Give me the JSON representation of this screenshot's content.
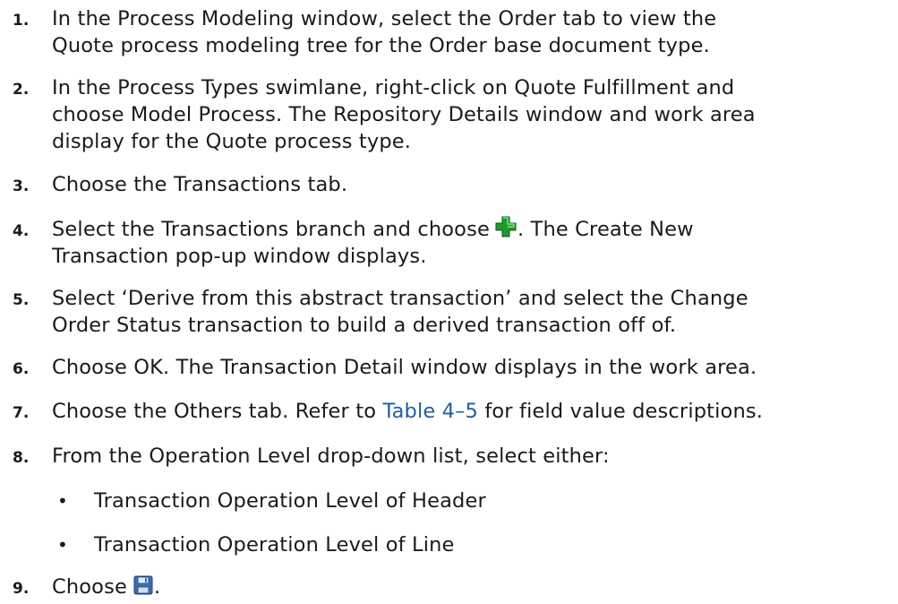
{
  "steps": [
    {
      "number": "1.",
      "lines": [
        "In the Process Modeling window, select the Order tab to view the",
        "Quote process modeling tree for the Order base document type."
      ]
    },
    {
      "number": "2.",
      "lines": [
        "In the Process Types swimlane, right-click on Quote Fulfillment and",
        "choose Model Process. The Repository Details window and work area",
        "display for the Quote process type."
      ]
    },
    {
      "number": "3.",
      "lines": [
        "Choose the Transactions tab."
      ]
    },
    {
      "number": "4.",
      "line1_before_icon": "Select the Transactions branch and choose",
      "line1_after_icon": ". The Create New",
      "line2": "Transaction pop-up window displays.",
      "icon": "add-green-plus-icon"
    },
    {
      "number": "5.",
      "lines": [
        "Select ‘Derive from this abstract transaction’ and select the Change",
        "Order Status transaction to build a derived transaction off of."
      ]
    },
    {
      "number": "6.",
      "lines": [
        "Choose OK. The Transaction Detail window displays in the work area."
      ]
    },
    {
      "number": "7.",
      "before_link": "Choose the Others tab. Refer to ",
      "link": "Table 4–5",
      "after_link": " for field value descriptions.",
      "link_color": "#1d5fa6"
    },
    {
      "number": "8.",
      "lines": [
        "From the Operation Level drop-down list, select either:"
      ],
      "bullets": [
        "Transaction Operation Level of Header",
        "Transaction Operation Level of Line"
      ]
    },
    {
      "number": "9.",
      "before_icon": "Choose",
      "after_icon": ".",
      "icon": "save-floppy-icon"
    }
  ]
}
